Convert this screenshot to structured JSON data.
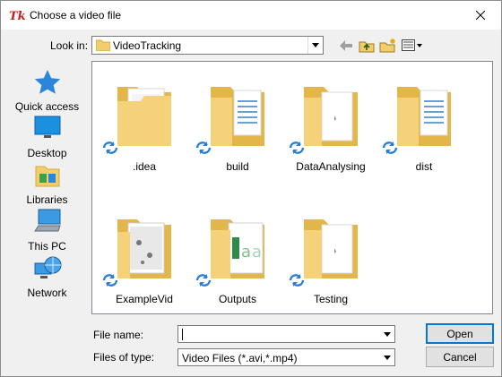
{
  "window": {
    "title": "Choose a video file",
    "title_icon": "tk-feather-icon",
    "close_icon": "close-icon"
  },
  "lookin": {
    "label": "Look in:",
    "value": "VideoTracking"
  },
  "toolbar": {
    "icons": [
      "back-arrow-icon",
      "up-folder-icon",
      "new-folder-icon",
      "view-menu-icon"
    ]
  },
  "places": [
    {
      "label": "Quick access",
      "icon": "star-icon"
    },
    {
      "label": "Desktop",
      "icon": "desktop-icon"
    },
    {
      "label": "Libraries",
      "icon": "libraries-icon"
    },
    {
      "label": "This PC",
      "icon": "computer-icon"
    },
    {
      "label": "Network",
      "icon": "network-icon"
    }
  ],
  "files": [
    {
      "name": ".idea"
    },
    {
      "name": "build"
    },
    {
      "name": "DataAnalysing"
    },
    {
      "name": "dist"
    },
    {
      "name": "ExampleVid"
    },
    {
      "name": "Outputs"
    },
    {
      "name": "Testing"
    }
  ],
  "form": {
    "filename_label": "File name:",
    "filename_value": "",
    "filetype_label": "Files of type:",
    "filetype_value": "Video Files (*.avi,*.mp4)"
  },
  "buttons": {
    "open": "Open",
    "cancel": "Cancel"
  },
  "colors": {
    "folder": "#f5d27a",
    "folder_dark": "#e2b649",
    "sync_blue": "#2a7fd4",
    "accent": "#0078d7"
  }
}
